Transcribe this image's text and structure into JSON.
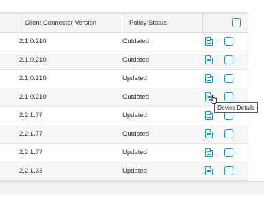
{
  "table": {
    "columns": [
      {
        "label": "Client Connector Version"
      },
      {
        "label": "Policy Status"
      }
    ],
    "rows": [
      {
        "version": "2.1.0.210",
        "status": "Outdated"
      },
      {
        "version": "2.1.0.210",
        "status": "Outdated"
      },
      {
        "version": "2.1.0.210",
        "status": "Updated"
      },
      {
        "version": "2.1.0.210",
        "status": "Outdated"
      },
      {
        "version": "2.2.1.77",
        "status": "Updated"
      },
      {
        "version": "2.2.1.77",
        "status": "Outdated"
      },
      {
        "version": "2.2.1.77",
        "status": "Updated"
      },
      {
        "version": "2.2.1.33",
        "status": "Updated"
      }
    ]
  },
  "tooltip": {
    "text": "Device Details"
  },
  "icons": {
    "row_action": "device-details-icon",
    "select": "checkbox",
    "scroll": "chevron-down-icon"
  },
  "colors": {
    "accent": "#1a8fc9",
    "header_bg": "#f4f4f4",
    "alt_row_bg": "#f6f6f6",
    "border": "#d8d8d8"
  }
}
